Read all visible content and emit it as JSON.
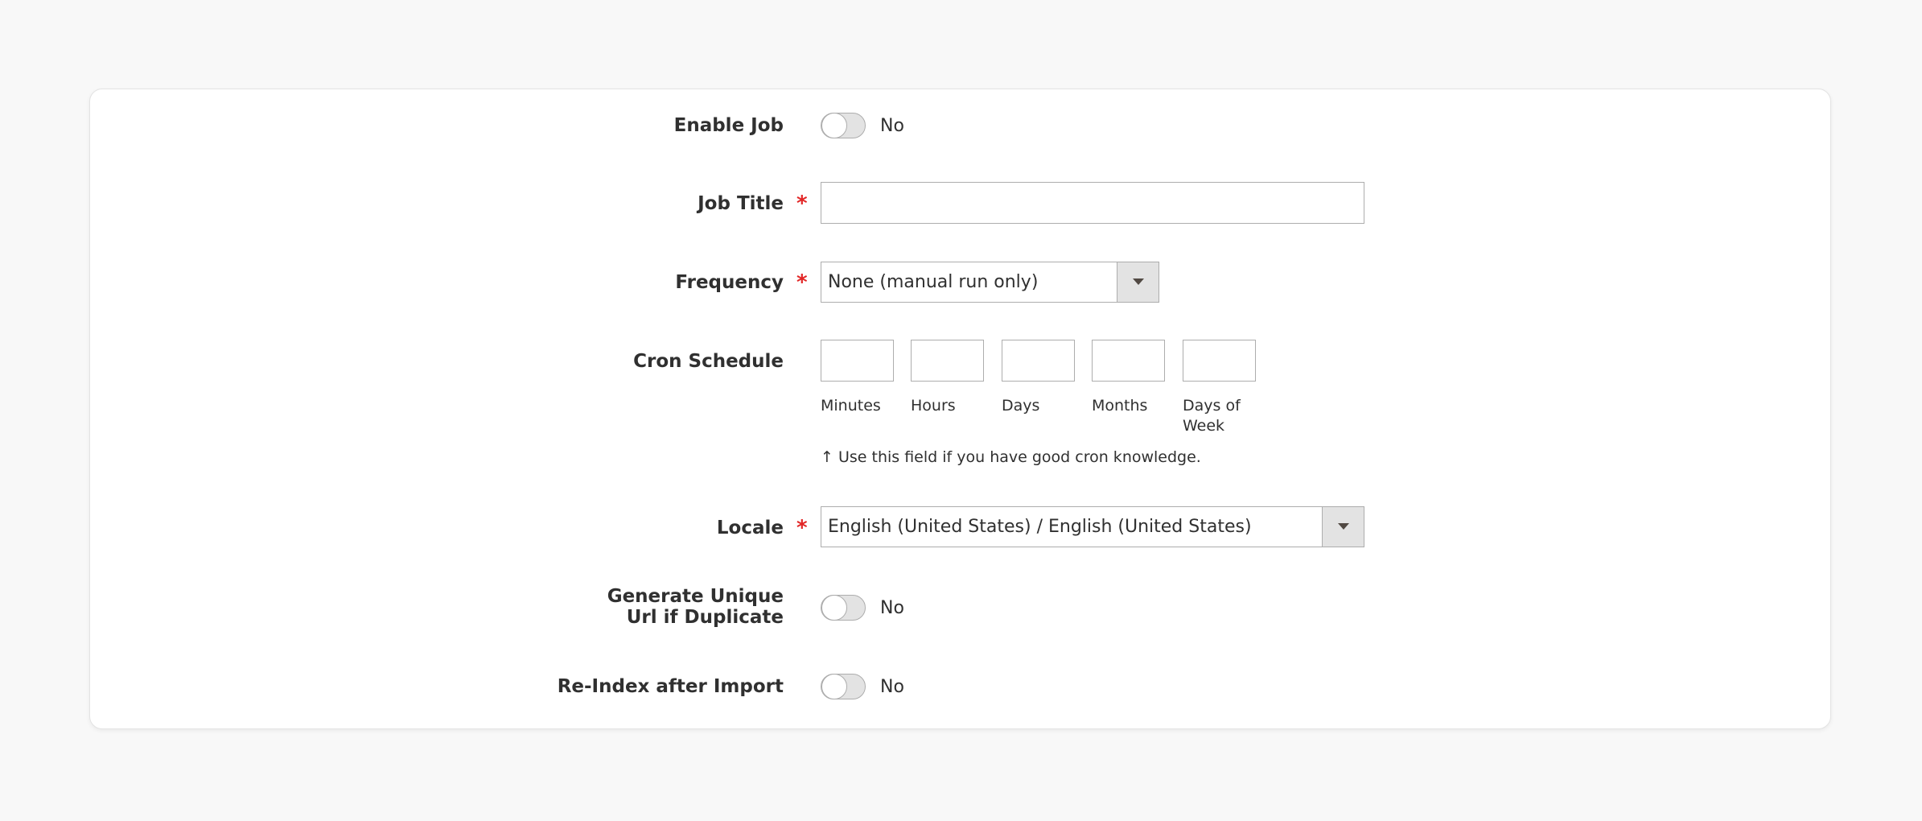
{
  "form": {
    "enable_job": {
      "label": "Enable Job",
      "value": "No"
    },
    "job_title": {
      "label": "Job Title",
      "required_mark": "*",
      "value": "",
      "placeholder": ""
    },
    "frequency": {
      "label": "Frequency",
      "required_mark": "*",
      "selected": "None (manual run only)"
    },
    "cron_schedule": {
      "label": "Cron Schedule",
      "fields": [
        {
          "label": "Minutes"
        },
        {
          "label": "Hours"
        },
        {
          "label": "Days"
        },
        {
          "label": "Months"
        },
        {
          "label": "Days of Week"
        }
      ],
      "note": "↑ Use this field if you have good cron knowledge."
    },
    "locale": {
      "label": "Locale",
      "required_mark": "*",
      "selected": "English (United States) / English (United States)"
    },
    "generate_unique_url": {
      "label": "Generate Unique Url if Duplicate",
      "value": "No"
    },
    "reindex_after_import": {
      "label": "Re-Index after Import",
      "value": "No"
    }
  },
  "colors": {
    "required": "#e22626",
    "toggle_off_bg": "#e3e3e3",
    "border": "#adadad",
    "page_bg": "#f8f8f8"
  },
  "icons": {
    "select_arrow": "chevron-down-icon"
  }
}
